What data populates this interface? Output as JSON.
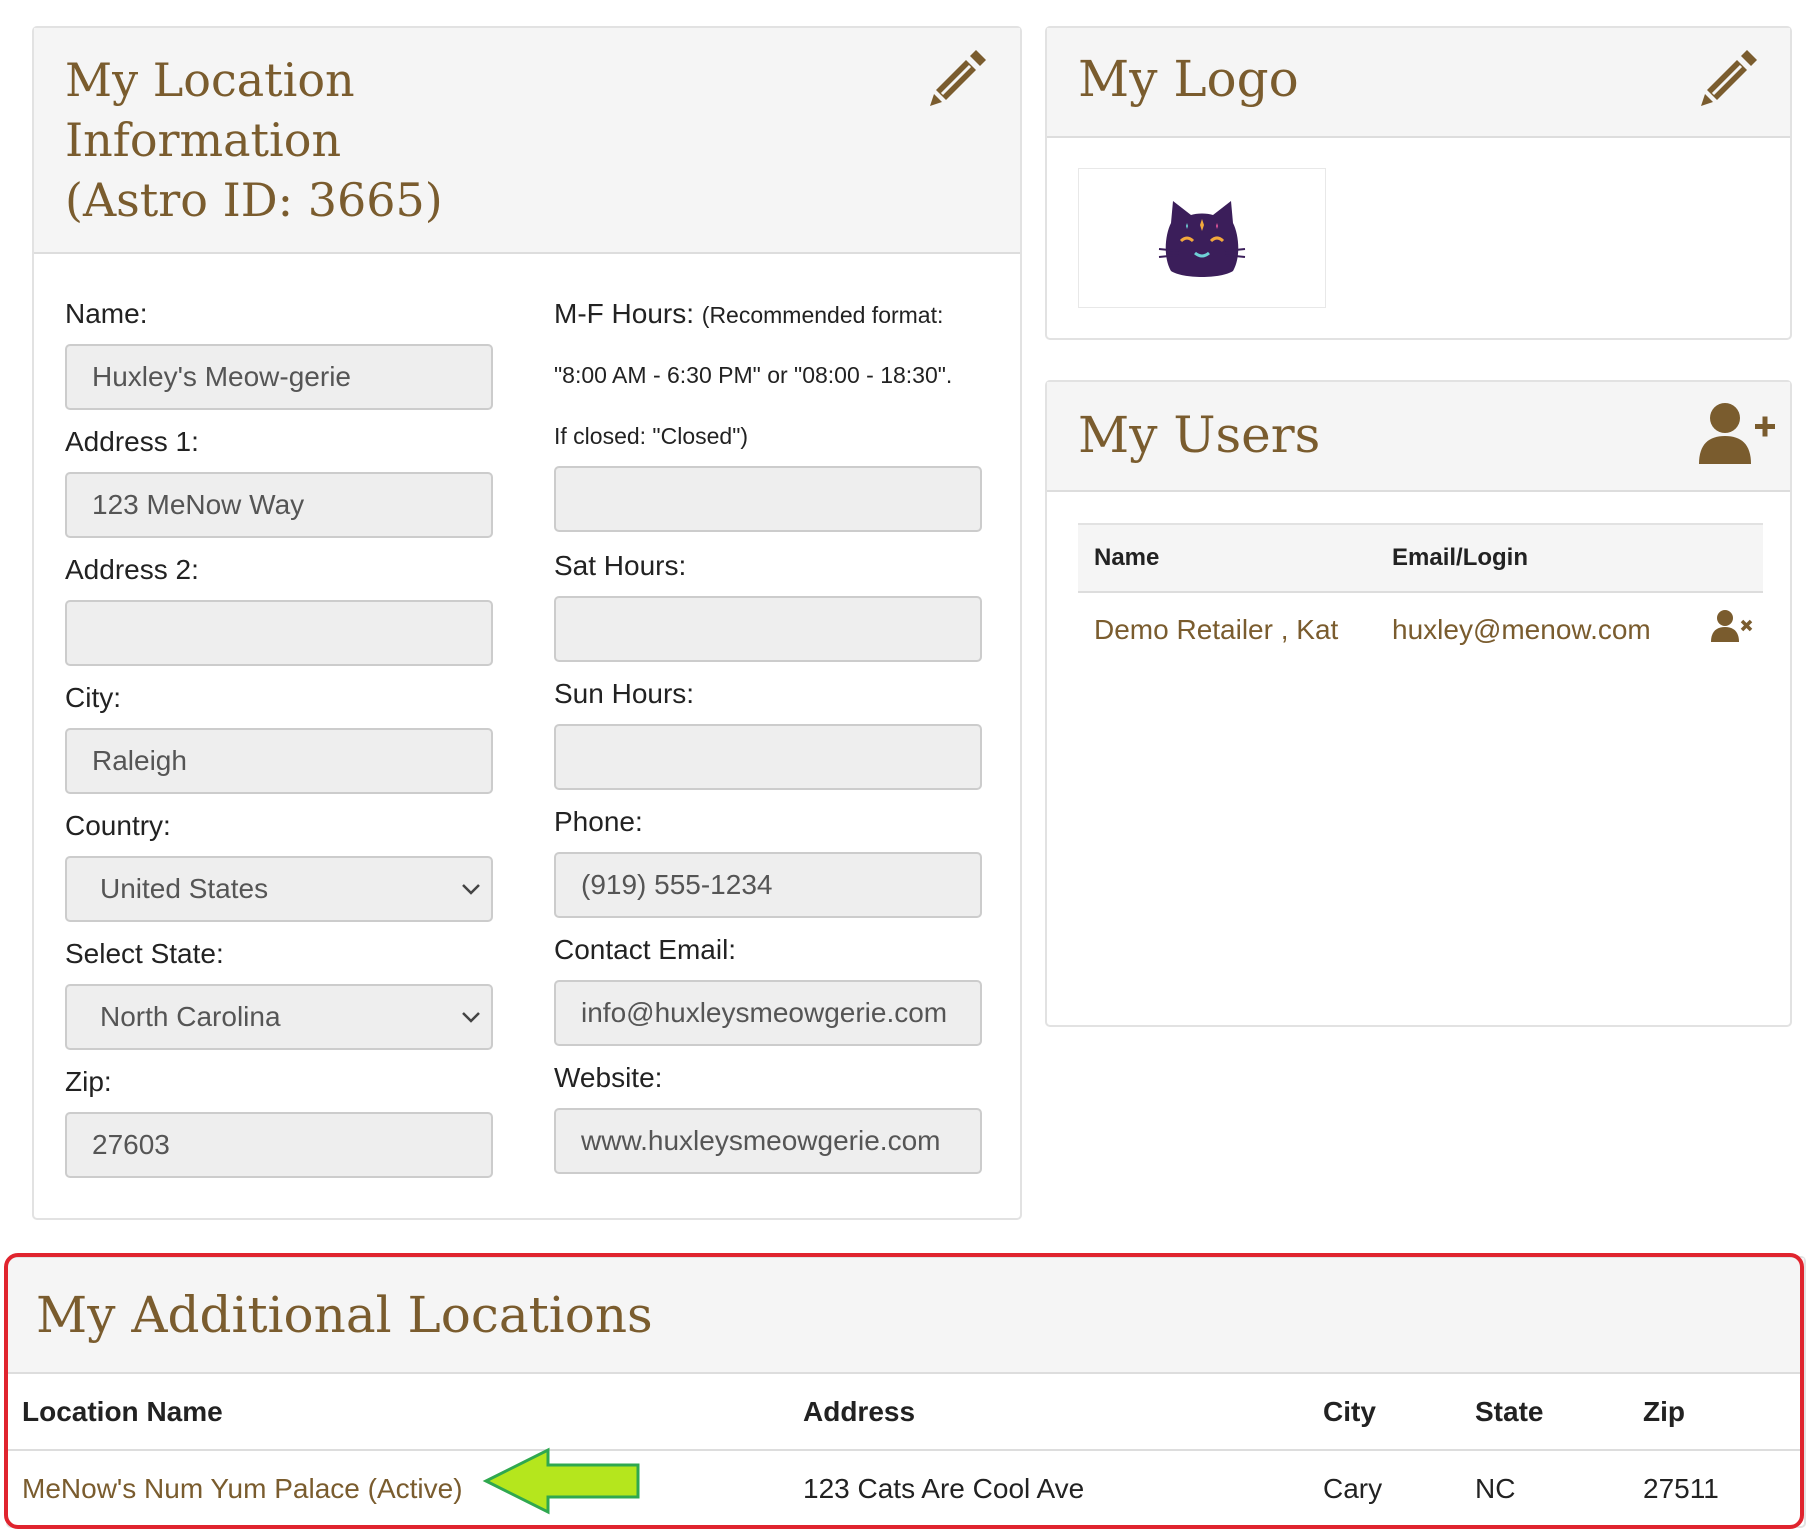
{
  "location_info": {
    "title_line1": "My Location",
    "title_line2": "Information",
    "title_line3": "(Astro ID: 3665)",
    "fields": {
      "name": {
        "label": "Name:",
        "value": "Huxley's Meow-gerie"
      },
      "address1": {
        "label": "Address 1:",
        "value": "123 MeNow Way"
      },
      "address2": {
        "label": "Address 2:",
        "value": ""
      },
      "city": {
        "label": "City:",
        "value": "Raleigh"
      },
      "country": {
        "label": "Country:",
        "value": "United States"
      },
      "state": {
        "label": "Select State:",
        "value": "North Carolina"
      },
      "zip": {
        "label": "Zip:",
        "value": "27603"
      },
      "mf_hours": {
        "label": "M-F Hours:",
        "hint_line1": "(Recommended format:",
        "hint_line2": "\"8:00 AM - 6:30 PM\" or \"08:00 - 18:30\".",
        "hint_line3": "If closed: \"Closed\")",
        "value": ""
      },
      "sat_hours": {
        "label": "Sat Hours:",
        "value": ""
      },
      "sun_hours": {
        "label": "Sun Hours:",
        "value": ""
      },
      "phone": {
        "label": "Phone:",
        "value": "(919) 555-1234"
      },
      "contact_email": {
        "label": "Contact Email:",
        "value": "info@huxleysmeowgerie.com"
      },
      "website": {
        "label": "Website:",
        "value": "www.huxleysmeowgerie.com"
      }
    }
  },
  "logo_panel": {
    "title": "My Logo"
  },
  "users_panel": {
    "title": "My Users",
    "columns": [
      "Name",
      "Email/Login"
    ],
    "rows": [
      {
        "name": "Demo Retailer , Kat",
        "email": "huxley@menow.com"
      }
    ]
  },
  "additional_locations": {
    "title": "My Additional Locations",
    "columns": [
      "Location Name",
      "Address",
      "City",
      "State",
      "Zip"
    ],
    "rows": [
      {
        "name": "MeNow's Num Yum Palace (Active)",
        "address": "123 Cats Are Cool Ave",
        "city": "Cary",
        "state": "NC",
        "zip": "27511"
      }
    ]
  },
  "colors": {
    "brand_brown": "#7a5c2e",
    "highlight_red": "#e0242e",
    "arrow_green": "#b5e61d",
    "panel_header_bg": "#f5f5f5"
  }
}
